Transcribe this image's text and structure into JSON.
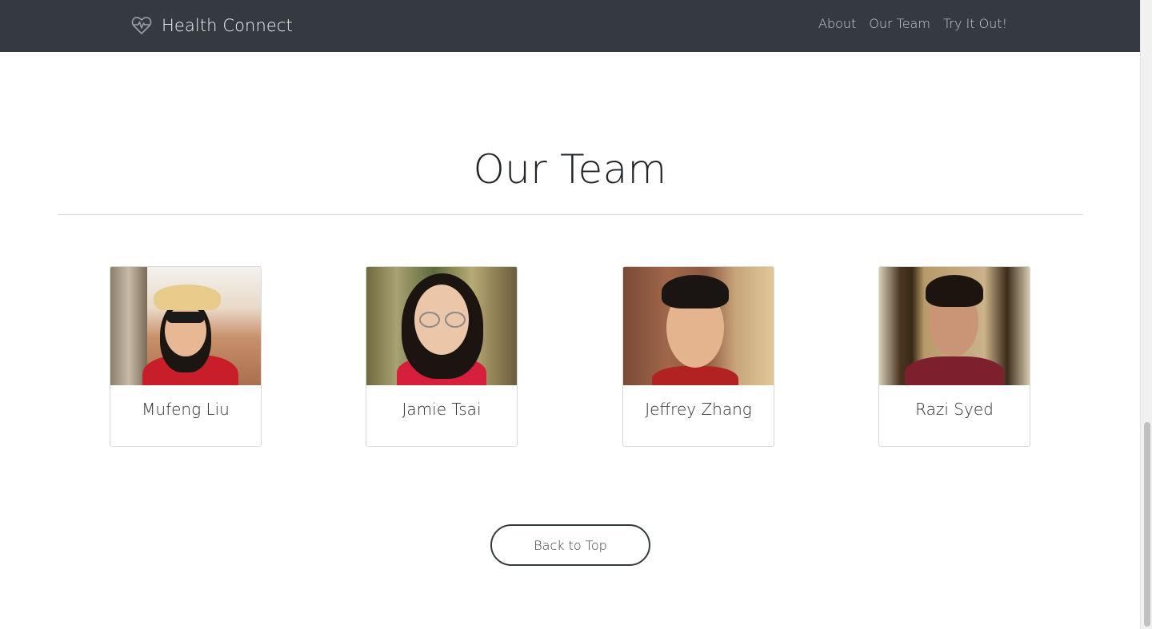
{
  "navbar": {
    "brand": "Health Connect",
    "brand_icon": "heart-pulse-icon",
    "links": [
      "About",
      "Our Team",
      "Try It Out!"
    ]
  },
  "section": {
    "title": "Our Team"
  },
  "team": [
    {
      "name": "Mufeng Liu"
    },
    {
      "name": "Jamie Tsai"
    },
    {
      "name": "Jeffrey Zhang"
    },
    {
      "name": "Razi Syed"
    }
  ],
  "back_button": "Back to Top",
  "colors": {
    "navbar_bg": "#343a40",
    "text_dark": "#212529",
    "nav_text": "#c9ccd0"
  }
}
